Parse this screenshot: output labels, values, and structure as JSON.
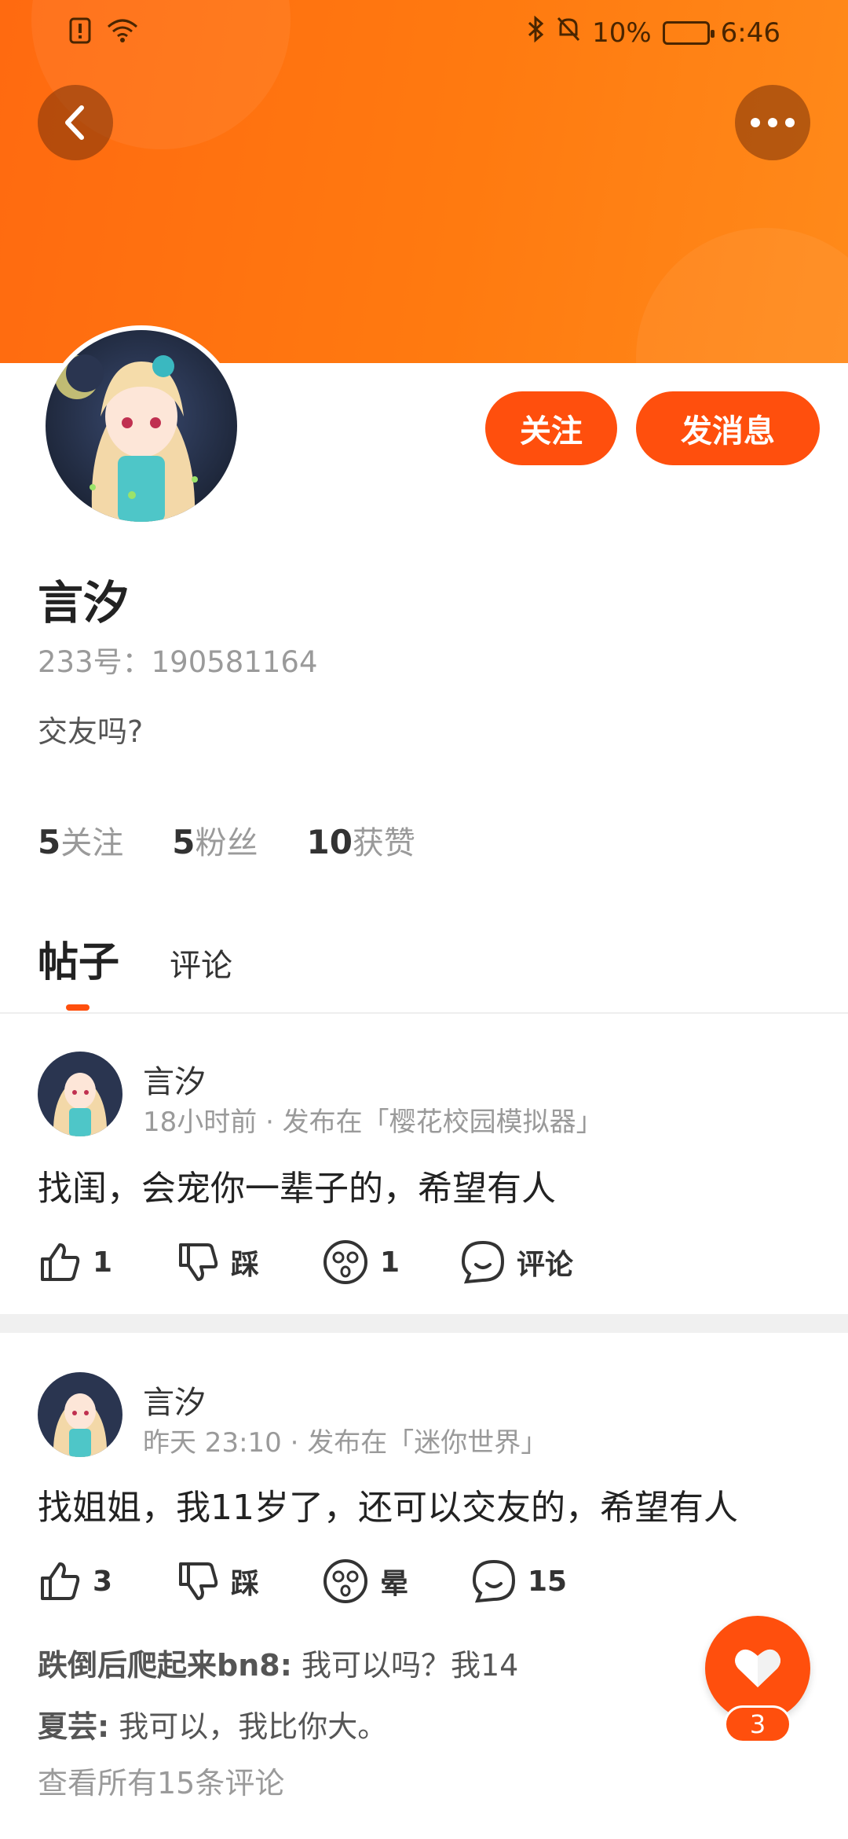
{
  "status_bar": {
    "battery": "10%",
    "time": "6:46"
  },
  "profile": {
    "name": "言汐",
    "uid": "233号：190581164",
    "bio": "交友吗?",
    "follow_label": "关注",
    "message_label": "发消息"
  },
  "stats": {
    "following_count": "5",
    "following_label": "关注",
    "fans_count": "5",
    "fans_label": "粉丝",
    "likes_count": "10",
    "likes_label": "获赞"
  },
  "tabs": [
    {
      "label": "帖子",
      "active": true
    },
    {
      "label": "评论",
      "active": false
    }
  ],
  "posts": [
    {
      "author": "言汐",
      "meta": "18小时前 · 发布在「樱花校园模拟器」",
      "text": "找闺，会宠你一辈子的，希望有人",
      "like_count": "1",
      "dislike_label": "踩",
      "dizzy_label": "1",
      "comment_label": "评论"
    },
    {
      "author": "言汐",
      "meta": "昨天 23:10 · 发布在「迷你世界」",
      "text": "找姐姐，我11岁了，还可以交友的，希望有人",
      "like_count": "3",
      "dislike_label": "踩",
      "dizzy_label": "晕",
      "comment_label": "15",
      "comments": [
        {
          "user": "跌倒后爬起来bn8:",
          "text": "我可以吗？我14"
        },
        {
          "user": "夏芸:",
          "text": "我可以，我比你大。"
        }
      ],
      "view_all": "查看所有15条评论"
    }
  ],
  "fab": {
    "count": "3"
  },
  "colors": {
    "accent": "#ff4f0d",
    "header": "#ff7a10"
  }
}
